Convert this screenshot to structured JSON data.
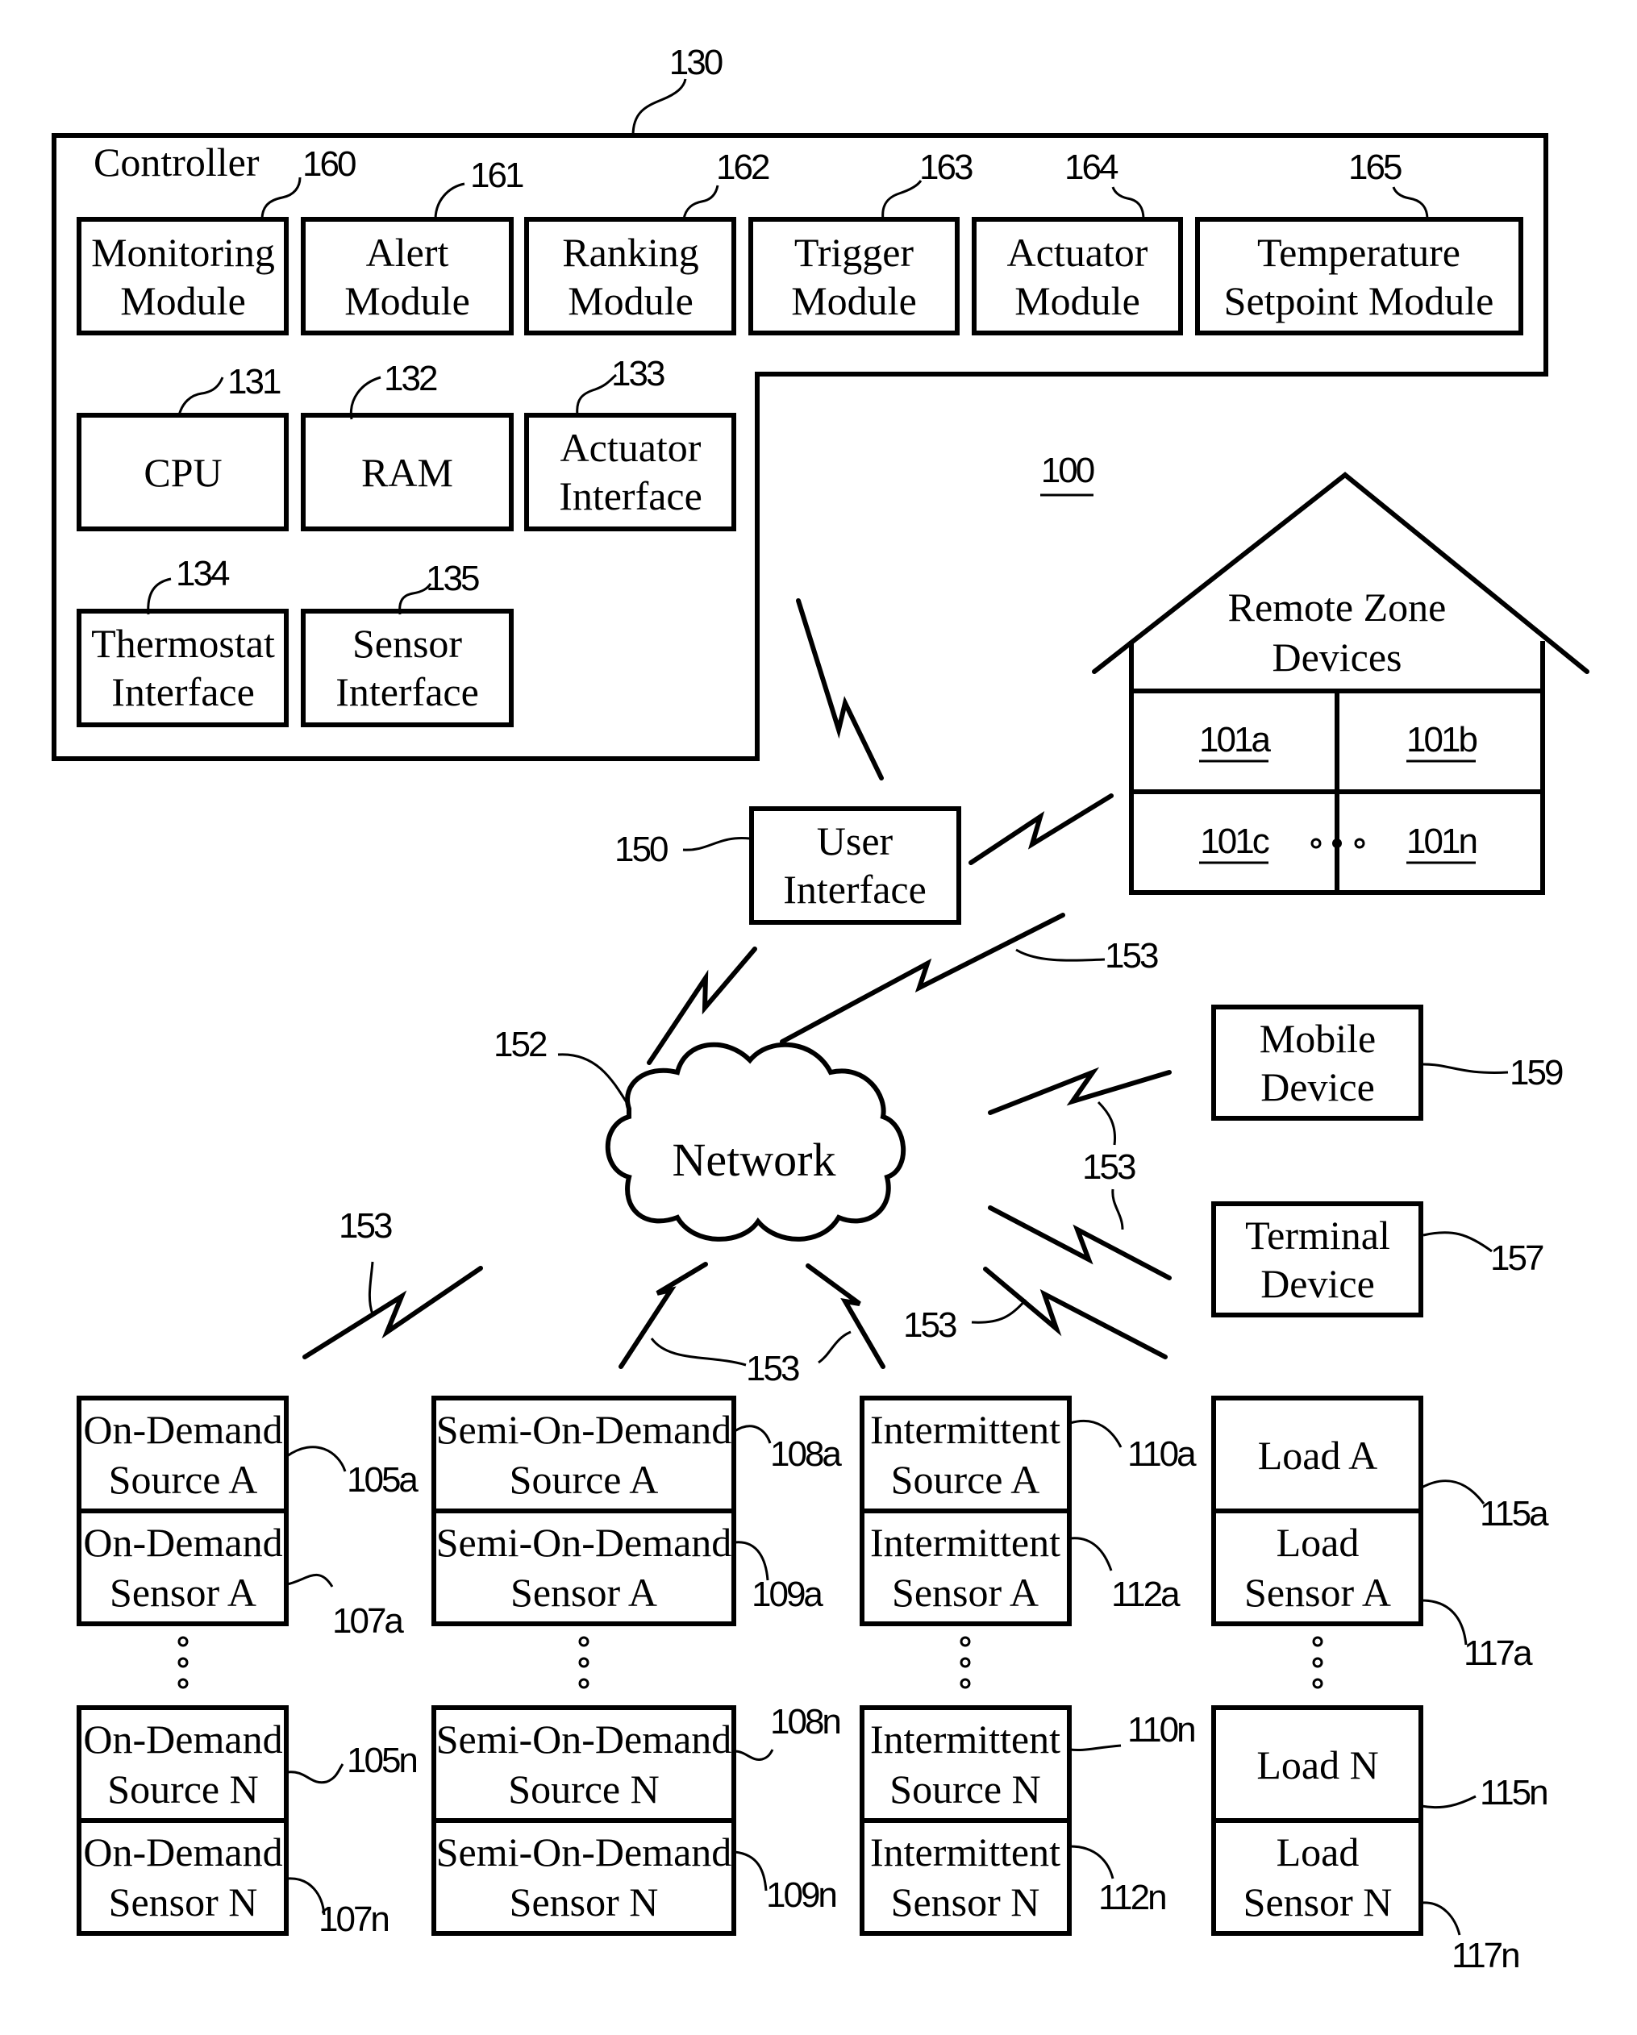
{
  "diagram": {
    "system_ref": "100",
    "controller": {
      "ref": "130",
      "title": "Controller",
      "modules": [
        {
          "ref": "160",
          "line1": "Monitoring",
          "line2": "Module"
        },
        {
          "ref": "161",
          "line1": "Alert",
          "line2": "Module"
        },
        {
          "ref": "162",
          "line1": "Ranking",
          "line2": "Module"
        },
        {
          "ref": "163",
          "line1": "Trigger",
          "line2": "Module"
        },
        {
          "ref": "164",
          "line1": "Actuator",
          "line2": "Module"
        },
        {
          "ref": "165",
          "line1": "Temperature",
          "line2": "Setpoint Module"
        }
      ],
      "components": [
        {
          "ref": "131",
          "line1": "CPU",
          "line2": ""
        },
        {
          "ref": "132",
          "line1": "RAM",
          "line2": ""
        },
        {
          "ref": "133",
          "line1": "Actuator",
          "line2": "Interface"
        },
        {
          "ref": "134",
          "line1": "Thermostat",
          "line2": "Interface"
        },
        {
          "ref": "135",
          "line1": "Sensor",
          "line2": "Interface"
        }
      ]
    },
    "remote_zone": {
      "line1": "Remote Zone",
      "line2": "Devices",
      "zones": [
        "101a",
        "101b",
        "101c",
        "101n"
      ]
    },
    "user_interface": {
      "ref": "150",
      "line1": "User",
      "line2": "Interface"
    },
    "network": {
      "ref": "152",
      "label": "Network"
    },
    "link_ref": "153",
    "mobile_device": {
      "ref": "159",
      "line1": "Mobile",
      "line2": "Device"
    },
    "terminal_device": {
      "ref": "157",
      "line1": "Terminal",
      "line2": "Device"
    },
    "columns": [
      {
        "top": [
          {
            "ref": "105a",
            "line1": "On-Demand",
            "line2": "Source A"
          },
          {
            "ref": "107a",
            "line1": "On-Demand",
            "line2": "Sensor A"
          }
        ],
        "bottom": [
          {
            "ref": "105n",
            "line1": "On-Demand",
            "line2": "Source N"
          },
          {
            "ref": "107n",
            "line1": "On-Demand",
            "line2": "Sensor N"
          }
        ]
      },
      {
        "top": [
          {
            "ref": "108a",
            "line1": "Semi-On-Demand",
            "line2": "Source A"
          },
          {
            "ref": "109a",
            "line1": "Semi-On-Demand",
            "line2": "Sensor A"
          }
        ],
        "bottom": [
          {
            "ref": "108n",
            "line1": "Semi-On-Demand",
            "line2": "Source N"
          },
          {
            "ref": "109n",
            "line1": "Semi-On-Demand",
            "line2": "Sensor N"
          }
        ]
      },
      {
        "top": [
          {
            "ref": "110a",
            "line1": "Intermittent",
            "line2": "Source A"
          },
          {
            "ref": "112a",
            "line1": "Intermittent",
            "line2": "Sensor A"
          }
        ],
        "bottom": [
          {
            "ref": "110n",
            "line1": "Intermittent",
            "line2": "Source N"
          },
          {
            "ref": "112n",
            "line1": "Intermittent",
            "line2": "Sensor N"
          }
        ]
      },
      {
        "top": [
          {
            "ref": "115a",
            "line1": "Load A",
            "line2": ""
          },
          {
            "ref": "117a",
            "line1": "Load",
            "line2": "Sensor A"
          }
        ],
        "bottom": [
          {
            "ref": "115n",
            "line1": "Load N",
            "line2": ""
          },
          {
            "ref": "117n",
            "line1": "Load",
            "line2": "Sensor N"
          }
        ]
      }
    ]
  }
}
